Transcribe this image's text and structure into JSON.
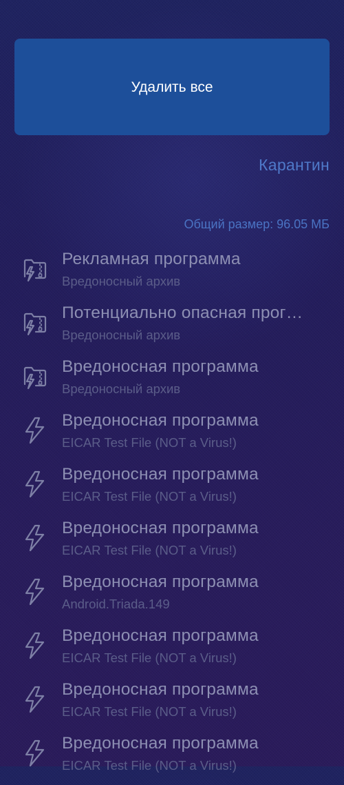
{
  "header": {
    "delete_all_label": "Удалить все",
    "quarantine_label": "Карантин",
    "total_size_label": "Общий размер: 96.05 МБ"
  },
  "colors": {
    "button_bg": "#1d4f9a",
    "link": "#4f79c9",
    "title_text": "#8d8fb3",
    "sub_text": "#5b5d89",
    "icon_stroke": "#7e80a6"
  },
  "threats": [
    {
      "icon": "archive-lightning-icon",
      "title": "Рекламная программа",
      "subtitle": "Вредоносный архив"
    },
    {
      "icon": "archive-lightning-icon",
      "title": "Потенциально опасная прог…",
      "subtitle": "Вредоносный архив"
    },
    {
      "icon": "archive-lightning-icon",
      "title": "Вредоносная программа",
      "subtitle": "Вредоносный архив"
    },
    {
      "icon": "lightning-icon",
      "title": "Вредоносная программа",
      "subtitle": "EICAR Test File (NOT a Virus!)"
    },
    {
      "icon": "lightning-icon",
      "title": "Вредоносная программа",
      "subtitle": "EICAR Test File (NOT a Virus!)"
    },
    {
      "icon": "lightning-icon",
      "title": "Вредоносная программа",
      "subtitle": "EICAR Test File (NOT a Virus!)"
    },
    {
      "icon": "lightning-icon",
      "title": "Вредоносная программа",
      "subtitle": "Android.Triada.149"
    },
    {
      "icon": "lightning-icon",
      "title": "Вредоносная программа",
      "subtitle": "EICAR Test File (NOT a Virus!)"
    },
    {
      "icon": "lightning-icon",
      "title": "Вредоносная программа",
      "subtitle": "EICAR Test File (NOT a Virus!)"
    },
    {
      "icon": "lightning-icon",
      "title": "Вредоносная программа",
      "subtitle": "EICAR Test File (NOT a Virus!)"
    }
  ]
}
